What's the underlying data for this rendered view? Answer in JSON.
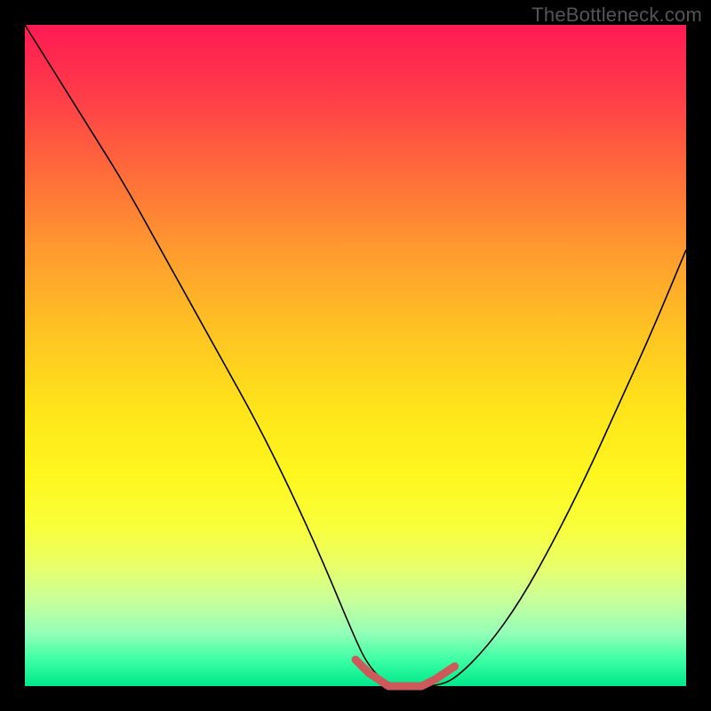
{
  "watermark": "TheBottleneck.com",
  "colors": {
    "frame": "#000000",
    "curve": "#000000",
    "trough": "#cc5a5a",
    "gradient_top": "#ff1a54",
    "gradient_bottom": "#00e88a"
  },
  "chart_data": {
    "type": "line",
    "title": "",
    "xlabel": "",
    "ylabel": "",
    "xlim": [
      0,
      100
    ],
    "ylim": [
      0,
      100
    ],
    "annotations": [
      "TheBottleneck.com"
    ],
    "series": [
      {
        "name": "bottleneck-curve",
        "x": [
          0,
          5,
          10,
          15,
          20,
          25,
          30,
          35,
          40,
          45,
          50,
          52,
          55,
          58,
          60,
          62,
          65,
          70,
          75,
          80,
          85,
          90,
          95,
          100
        ],
        "values": [
          100,
          92,
          84,
          76,
          67,
          58,
          49,
          40,
          30,
          19,
          7,
          3,
          0,
          0,
          0,
          0,
          1,
          6,
          13,
          22,
          32,
          43,
          54,
          66
        ]
      },
      {
        "name": "optimal-zone",
        "x": [
          50,
          52,
          55,
          58,
          60,
          62,
          65
        ],
        "values": [
          4,
          2,
          0,
          0,
          0,
          1,
          3
        ]
      }
    ]
  }
}
